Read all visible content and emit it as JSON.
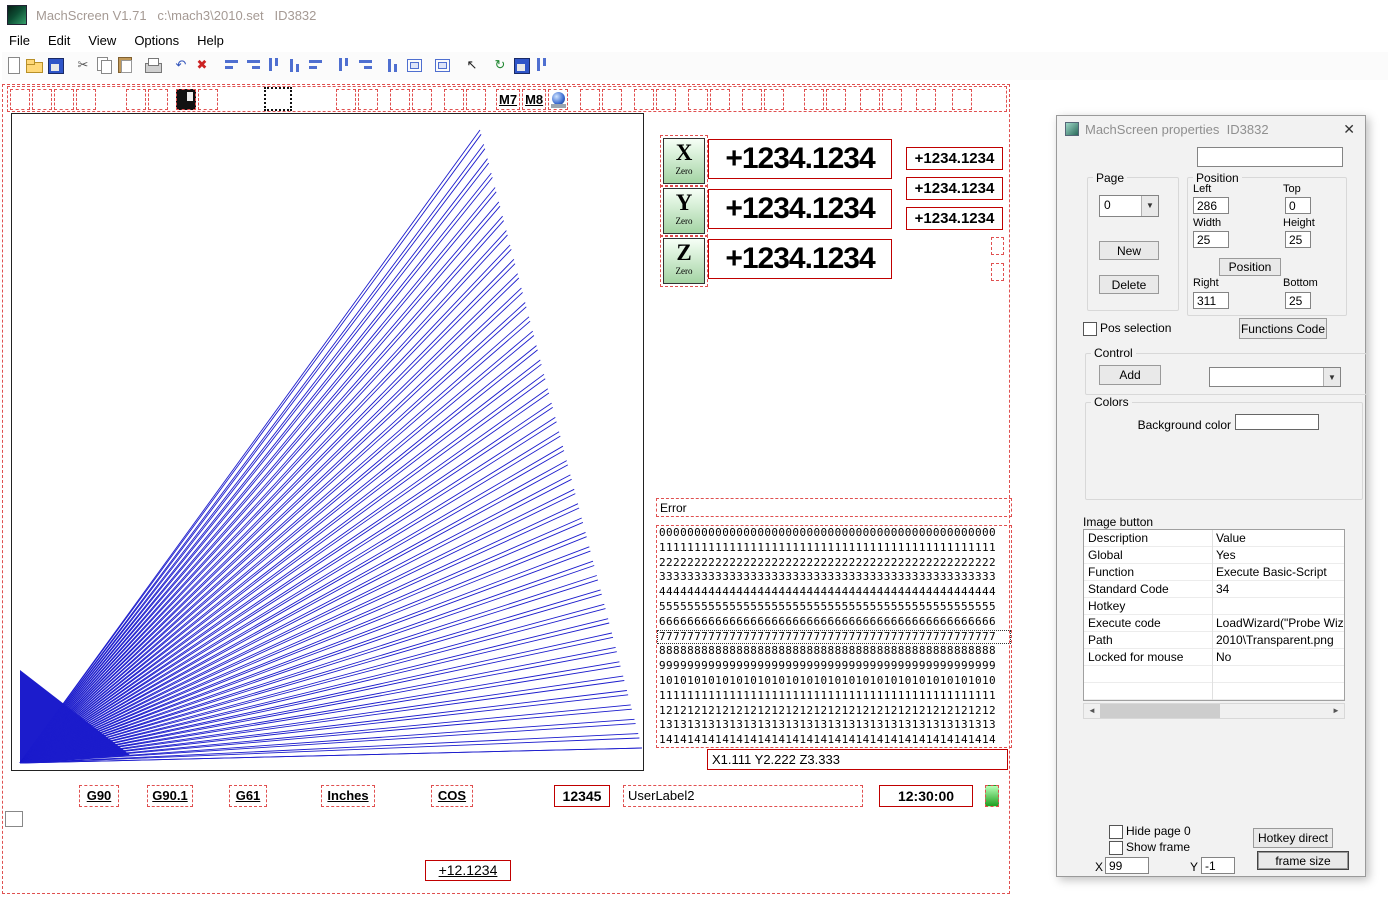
{
  "window": {
    "title": "MachScreen V1.71   c:\\mach3\\2010.set   ID3832"
  },
  "menu": {
    "items": [
      "File",
      "Edit",
      "View",
      "Options",
      "Help"
    ]
  },
  "toolbar": {
    "icons": [
      {
        "name": "new-document-icon",
        "kind": "doc"
      },
      {
        "name": "open-folder-icon",
        "kind": "folder"
      },
      {
        "name": "save-icon",
        "kind": "save"
      },
      {
        "name": "cut-icon",
        "glyph": "✂",
        "color": "#555555",
        "gap": 8
      },
      {
        "name": "copy-icon",
        "kind": "copy"
      },
      {
        "name": "paste-icon",
        "kind": "paste"
      },
      {
        "name": "print-icon",
        "kind": "print",
        "gap": 8
      },
      {
        "name": "undo-icon",
        "glyph": "↶",
        "color": "#3355bb",
        "gap": 8
      },
      {
        "name": "delete-icon",
        "glyph": "✖",
        "color": "#cc2222"
      },
      {
        "name": "align-left-icon",
        "kind": "barsH",
        "gap": 10
      },
      {
        "name": "align-right-icon",
        "kind": "barsHr"
      },
      {
        "name": "align-top-icon",
        "kind": "barsV"
      },
      {
        "name": "align-bottom-icon",
        "kind": "barsVb"
      },
      {
        "name": "center-horizontal-icon",
        "kind": "barsH"
      },
      {
        "name": "center-vertical-icon",
        "kind": "barsV",
        "gap": 8
      },
      {
        "name": "same-width-icon",
        "kind": "barsHr"
      },
      {
        "name": "same-height-icon",
        "kind": "barsVb",
        "gap": 8
      },
      {
        "name": "same-size-icon",
        "kind": "rect"
      },
      {
        "name": "grid-icon",
        "kind": "rect",
        "gap": 8
      },
      {
        "name": "select-arrow-icon",
        "glyph": "↖",
        "color": "#222222",
        "gap": 10
      },
      {
        "name": "refresh-icon",
        "glyph": "↻",
        "color": "#228833",
        "gap": 8
      },
      {
        "name": "save-screen-icon",
        "kind": "save"
      },
      {
        "name": "preview-icon",
        "kind": "barsV"
      }
    ]
  },
  "design": {
    "top_buttons": [
      {},
      {},
      {},
      {},
      {
        "gap": 30
      },
      {},
      {
        "gap": 8,
        "type": "black",
        "name": "image-button-black"
      },
      {},
      {
        "gap": 46,
        "type": "selected",
        "name": "selected-image-button"
      },
      {
        "gap": 44
      },
      {},
      {
        "gap": 12
      },
      {},
      {
        "gap": 12
      },
      {},
      {
        "gap": 10,
        "label": "M7",
        "name": "m7-button"
      },
      {
        "label": "M8",
        "name": "m8-button"
      },
      {
        "type": "cam",
        "name": "webcam-button"
      },
      {
        "gap": 12
      },
      {},
      {
        "gap": 12
      },
      {},
      {
        "gap": 12
      },
      {},
      {
        "gap": 12
      },
      {},
      {
        "gap": 20
      },
      {},
      {
        "gap": 14
      },
      {},
      {
        "gap": 14
      },
      {
        "gap": 16
      }
    ],
    "dro": {
      "zero_label": "Zero",
      "axes": [
        {
          "letter": "X",
          "value": "+1234.1234"
        },
        {
          "letter": "Y",
          "value": "+1234.1234"
        },
        {
          "letter": "Z",
          "value": "+1234.1234"
        }
      ]
    },
    "small_dros": [
      "+1234.1234",
      "+1234.1234",
      "+1234.1234"
    ],
    "error_label": "Error",
    "digit_rows": [
      "000000000000000000000000000000000000000000000000",
      "111111111111111111111111111111111111111111111111",
      "222222222222222222222222222222222222222222222222",
      "333333333333333333333333333333333333333333333333",
      "444444444444444444444444444444444444444444444444",
      "555555555555555555555555555555555555555555555555",
      "666666666666666666666666666666666666666666666666",
      "777777777777777777777777777777777777777777777777",
      "888888888888888888888888888888888888888888888888",
      "999999999999999999999999999999999999999999999999",
      "101010101010101010101010101010101010101010101010",
      "111111111111111111111111111111111111111111111111",
      "121212121212121212121212121212121212121212121212",
      "131313131313131313131313131313131313131313131313",
      "141414141414141414141414141414141414141414141414"
    ],
    "selected_digit_row": 7,
    "position_label": "X1.111 Y2.222 Z3.333",
    "bottom_labels": [
      {
        "text": "G90",
        "underline": true,
        "name": "g90-label"
      },
      {
        "text": "G90.1",
        "underline": true,
        "name": "g901-label"
      },
      {
        "text": "G61",
        "underline": true,
        "name": "g61-label"
      },
      {
        "text": "Inches",
        "underline": true,
        "name": "units-label"
      },
      {
        "text": "COS",
        "underline": true,
        "name": "cos-label"
      },
      {
        "text": "12345",
        "style": "solid",
        "bold": true,
        "name": "line-number-dro"
      },
      {
        "text": "UserLabel2",
        "align": "left",
        "name": "user-label"
      },
      {
        "text": "12:30:00",
        "style": "solid",
        "bold": true,
        "name": "clock-dro"
      },
      {
        "text": "",
        "style": "led",
        "name": "led-indicator"
      }
    ],
    "value_label": "+12.1234"
  },
  "properties": {
    "title": "MachScreen properties  ID3832",
    "search_value": "",
    "page": {
      "label": "Page",
      "value": "0",
      "new_label": "New",
      "delete_label": "Delete"
    },
    "position": {
      "label": "Position",
      "left_label": "Left",
      "left": "286",
      "top_label": "Top",
      "top": "0",
      "width_label": "Width",
      "width": "25",
      "height_label": "Height",
      "height": "25",
      "button_label": "Position",
      "right_label": "Right",
      "right": "311",
      "bottom_label": "Bottom",
      "bottom": "25"
    },
    "pos_selection_label": "Pos selection",
    "functions_code_label": "Functions Code",
    "control": {
      "label": "Control",
      "add_label": "Add",
      "selector_value": ""
    },
    "colors": {
      "label": "Colors",
      "background_label": "Background color"
    },
    "image_button": {
      "label": "Image button",
      "columns": [
        "Description",
        "Value"
      ],
      "rows": [
        [
          "Global",
          "Yes"
        ],
        [
          "Function",
          "Execute Basic-Script"
        ],
        [
          "Standard Code",
          "34"
        ],
        [
          "Hotkey",
          ""
        ],
        [
          "Execute code",
          "LoadWizard(\"Probe Wizar."
        ],
        [
          "Path",
          "2010\\Transparent.png"
        ],
        [
          "Locked for mouse",
          "No"
        ]
      ]
    },
    "hide_page_label": "Hide page 0",
    "show_frame_label": "Show frame",
    "hotkey_direct_label": "Hotkey direct",
    "frame_size_label": "frame size",
    "x_label": "X",
    "x_value": "99",
    "y_label": "Y",
    "y_value": "-1"
  }
}
